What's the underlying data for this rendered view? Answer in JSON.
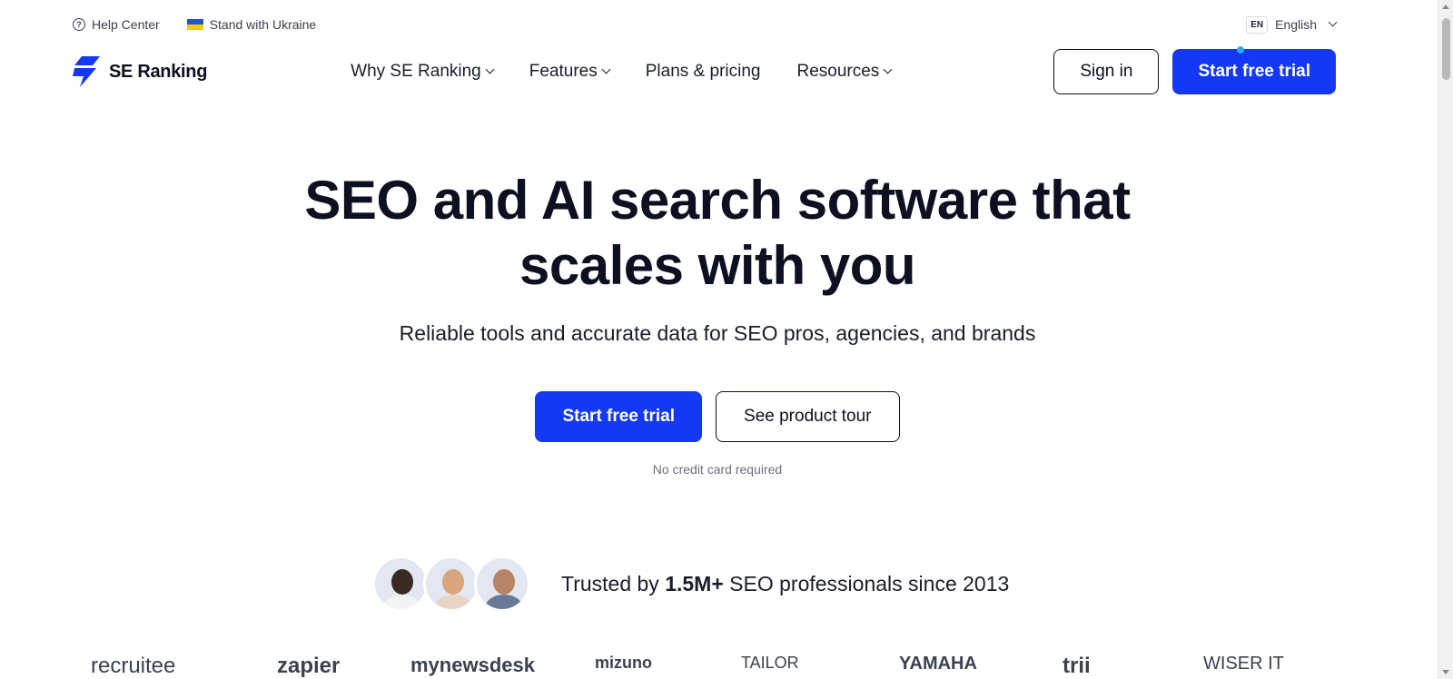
{
  "colors": {
    "primary": "#1538f5",
    "text": "#0d1020",
    "muted": "#6b6f7e",
    "notify_dot": "#2fa8ff"
  },
  "utility_bar": {
    "help_center": "Help Center",
    "ukraine": "Stand with Ukraine",
    "lang_code": "EN",
    "lang_label": "English"
  },
  "nav": {
    "logo_text": "SE Ranking",
    "items": [
      {
        "label": "Why SE Ranking",
        "has_dropdown": true
      },
      {
        "label": "Features",
        "has_dropdown": true
      },
      {
        "label": "Plans & pricing",
        "has_dropdown": false
      },
      {
        "label": "Resources",
        "has_dropdown": true
      }
    ],
    "sign_in": "Sign in",
    "start_trial": "Start free trial"
  },
  "hero": {
    "title": "SEO and AI search software that scales with you",
    "subtitle": "Reliable tools and accurate data for SEO pros, agencies, and brands",
    "primary_cta": "Start free trial",
    "secondary_cta": "See product tour",
    "note": "No credit card required"
  },
  "trusted": {
    "prefix": "Trusted by",
    "highlight": "1.5M+",
    "suffix": "SEO professionals since 2013"
  },
  "client_logos": [
    "recruitee",
    "zapier",
    "mynewsdesk",
    "mizuno",
    "TAILOR",
    "YAMAHA",
    "trii",
    "WISER IT"
  ]
}
